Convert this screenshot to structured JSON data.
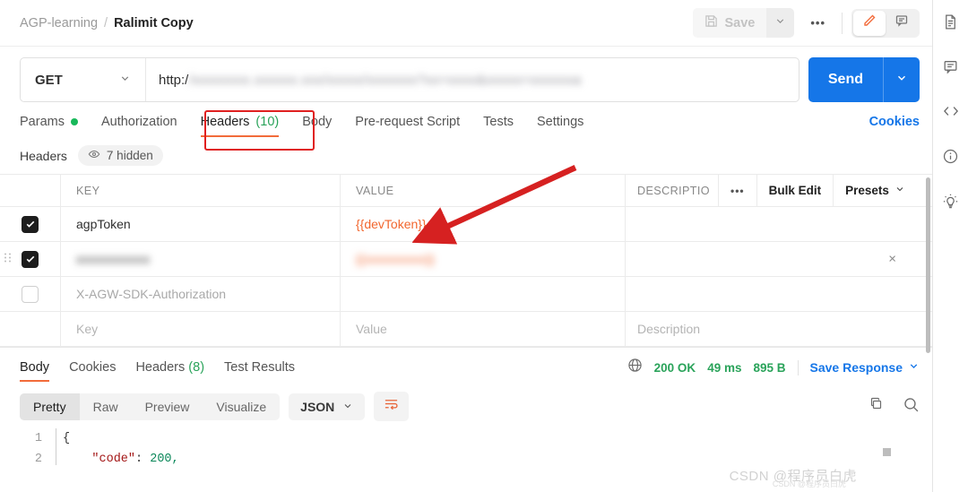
{
  "header": {
    "breadcrumb_root": "AGP-learning",
    "breadcrumb_sep": "/",
    "breadcrumb_current": "Ralimit Copy",
    "save_label": "Save",
    "more_label": "•••",
    "icons": {
      "save": "floppy-disk-icon",
      "save_caret": "chevron-down-icon",
      "edit": "pencil-icon",
      "comment": "comment-icon"
    }
  },
  "request": {
    "method": "GET",
    "method_caret": "∨",
    "url_prefix": "http:/",
    "url_redacted": "/xxxxxxxx.xxxxxx.xxx/xxxxx/xxxxxxx?xx=xxxx&xxxxx=xxxxxxa",
    "send_label": "Send",
    "send_caret": "∨"
  },
  "request_tabs": [
    {
      "label": "Params",
      "badge": "dot",
      "active": false
    },
    {
      "label": "Authorization",
      "badge": "",
      "active": false
    },
    {
      "label": "Headers",
      "badge": "(10)",
      "active": true
    },
    {
      "label": "Body",
      "badge": "",
      "active": false
    },
    {
      "label": "Pre-request Script",
      "badge": "",
      "active": false
    },
    {
      "label": "Tests",
      "badge": "",
      "active": false
    },
    {
      "label": "Settings",
      "badge": "",
      "active": false
    }
  ],
  "cookies_link": "Cookies",
  "headers_section": {
    "title": "Headers",
    "hidden_pill": "7 hidden",
    "eye_icon": "eye-icon"
  },
  "table": {
    "columns": {
      "key": "KEY",
      "value": "VALUE",
      "description": "DESCRIPTIO"
    },
    "tools": {
      "dots": "•••",
      "bulk_edit": "Bulk Edit",
      "presets": "Presets",
      "presets_caret": "∨"
    },
    "rows": [
      {
        "checked": true,
        "key": "agpToken",
        "value": "{{devToken}}",
        "value_kind": "variable",
        "description": "",
        "state": "normal"
      },
      {
        "checked": true,
        "key": "xxxxxxxxxxx",
        "value": "{{xxxxxxxxx}}",
        "value_kind": "variable",
        "description": "",
        "state": "blurred",
        "close": "×"
      },
      {
        "checked": false,
        "key": "X-AGW-SDK-Authorization",
        "value": "",
        "value_kind": "plain",
        "description": "",
        "state": "disabled"
      },
      {
        "checked": false,
        "key": "Key",
        "value": "Value",
        "value_kind": "plain",
        "description": "Description",
        "state": "placeholder"
      }
    ]
  },
  "response": {
    "tabs": [
      {
        "label": "Body",
        "badge": "",
        "active": true
      },
      {
        "label": "Cookies",
        "badge": "",
        "active": false
      },
      {
        "label": "Headers",
        "badge": "(8)",
        "active": false
      },
      {
        "label": "Test Results",
        "badge": "",
        "active": false
      }
    ],
    "globe_icon": "globe-icon",
    "status": "200 OK",
    "time": "49 ms",
    "size": "895 B",
    "save_response": "Save Response",
    "save_response_caret": "∨",
    "view_modes": [
      {
        "label": "Pretty",
        "active": true
      },
      {
        "label": "Raw",
        "active": false
      },
      {
        "label": "Preview",
        "active": false
      },
      {
        "label": "Visualize",
        "active": false
      }
    ],
    "format": "JSON",
    "format_caret": "∨",
    "wrap_icon": "word-wrap-icon",
    "copy_icon": "copy-icon",
    "search_icon": "search-icon",
    "code_lines": [
      {
        "num": "1",
        "text": "{",
        "key": "",
        "value": ""
      },
      {
        "num": "2",
        "text": "",
        "key": "\"code\"",
        "value": "200,"
      }
    ]
  },
  "right_rail": [
    {
      "icon": "document-icon"
    },
    {
      "icon": "comment-icon"
    },
    {
      "icon": "code-icon"
    },
    {
      "icon": "info-icon"
    },
    {
      "icon": "lightbulb-icon"
    }
  ],
  "annotations": {
    "box_target": "headers-tab",
    "arrow_target": "devToken-value",
    "color": "#e02020"
  },
  "watermark": {
    "main": "CSDN @程序员白虎",
    "sub": "CSDN @程序员白虎"
  },
  "colors": {
    "accent_orange": "#f26b3a",
    "link_blue": "#1576e8",
    "success_green": "#2aa35a",
    "annotation_red": "#e02020"
  }
}
